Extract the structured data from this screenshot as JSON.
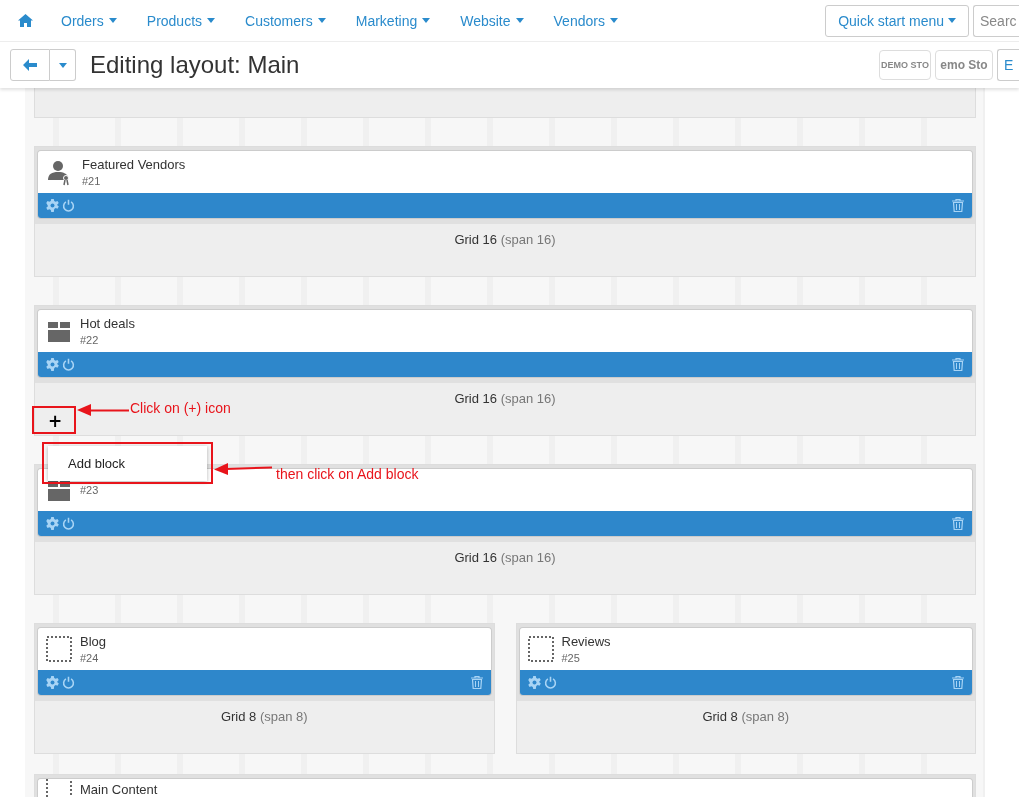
{
  "nav": {
    "items": [
      {
        "label": "Orders"
      },
      {
        "label": "Products"
      },
      {
        "label": "Customers"
      },
      {
        "label": "Marketing"
      },
      {
        "label": "Website"
      },
      {
        "label": "Vendors"
      }
    ],
    "quick_start": "Quick start menu",
    "search": {
      "placeholder": "Searc"
    }
  },
  "header": {
    "title": "Editing layout: Main",
    "logos": [
      "DEMO STO",
      "emo Sto"
    ],
    "cut_button": "E"
  },
  "rows": [
    {
      "kind": "partial"
    },
    {
      "kind": "full",
      "grids": [
        {
          "label": "Grid 16",
          "span": "(span 16)",
          "blocks": [
            {
              "kind": "vendor",
              "title": "Featured Vendors",
              "id": "#21"
            }
          ]
        }
      ]
    },
    {
      "kind": "full",
      "grids": [
        {
          "label": "Grid 16",
          "span": "(span 16)",
          "add_button": "+",
          "blocks": [
            {
              "kind": "box",
              "title": "Hot deals",
              "id": "#22"
            }
          ]
        }
      ]
    },
    {
      "kind": "full",
      "grids": [
        {
          "label": "Grid 16",
          "span": "(span 16)",
          "blocks": [
            {
              "kind": "box",
              "id": "#23"
            }
          ]
        }
      ]
    },
    {
      "kind": "full",
      "grids": [
        {
          "label": "Grid 8",
          "span": "(span 8)",
          "blocks": [
            {
              "kind": "placeholder",
              "title": "Blog",
              "id": "#24"
            }
          ]
        },
        {
          "label": "Grid 8",
          "span": "(span 8)",
          "blocks": [
            {
              "kind": "placeholder",
              "title": "Reviews",
              "id": "#25"
            }
          ]
        }
      ]
    },
    {
      "kind": "cut",
      "grids": [
        {
          "blocks": [
            {
              "kind": "placeholder",
              "title": "Main Content"
            }
          ]
        }
      ]
    }
  ],
  "menu": {
    "items": [
      "Add block"
    ]
  },
  "annotations": [
    "Click on (+)  icon",
    "then click on Add block"
  ]
}
